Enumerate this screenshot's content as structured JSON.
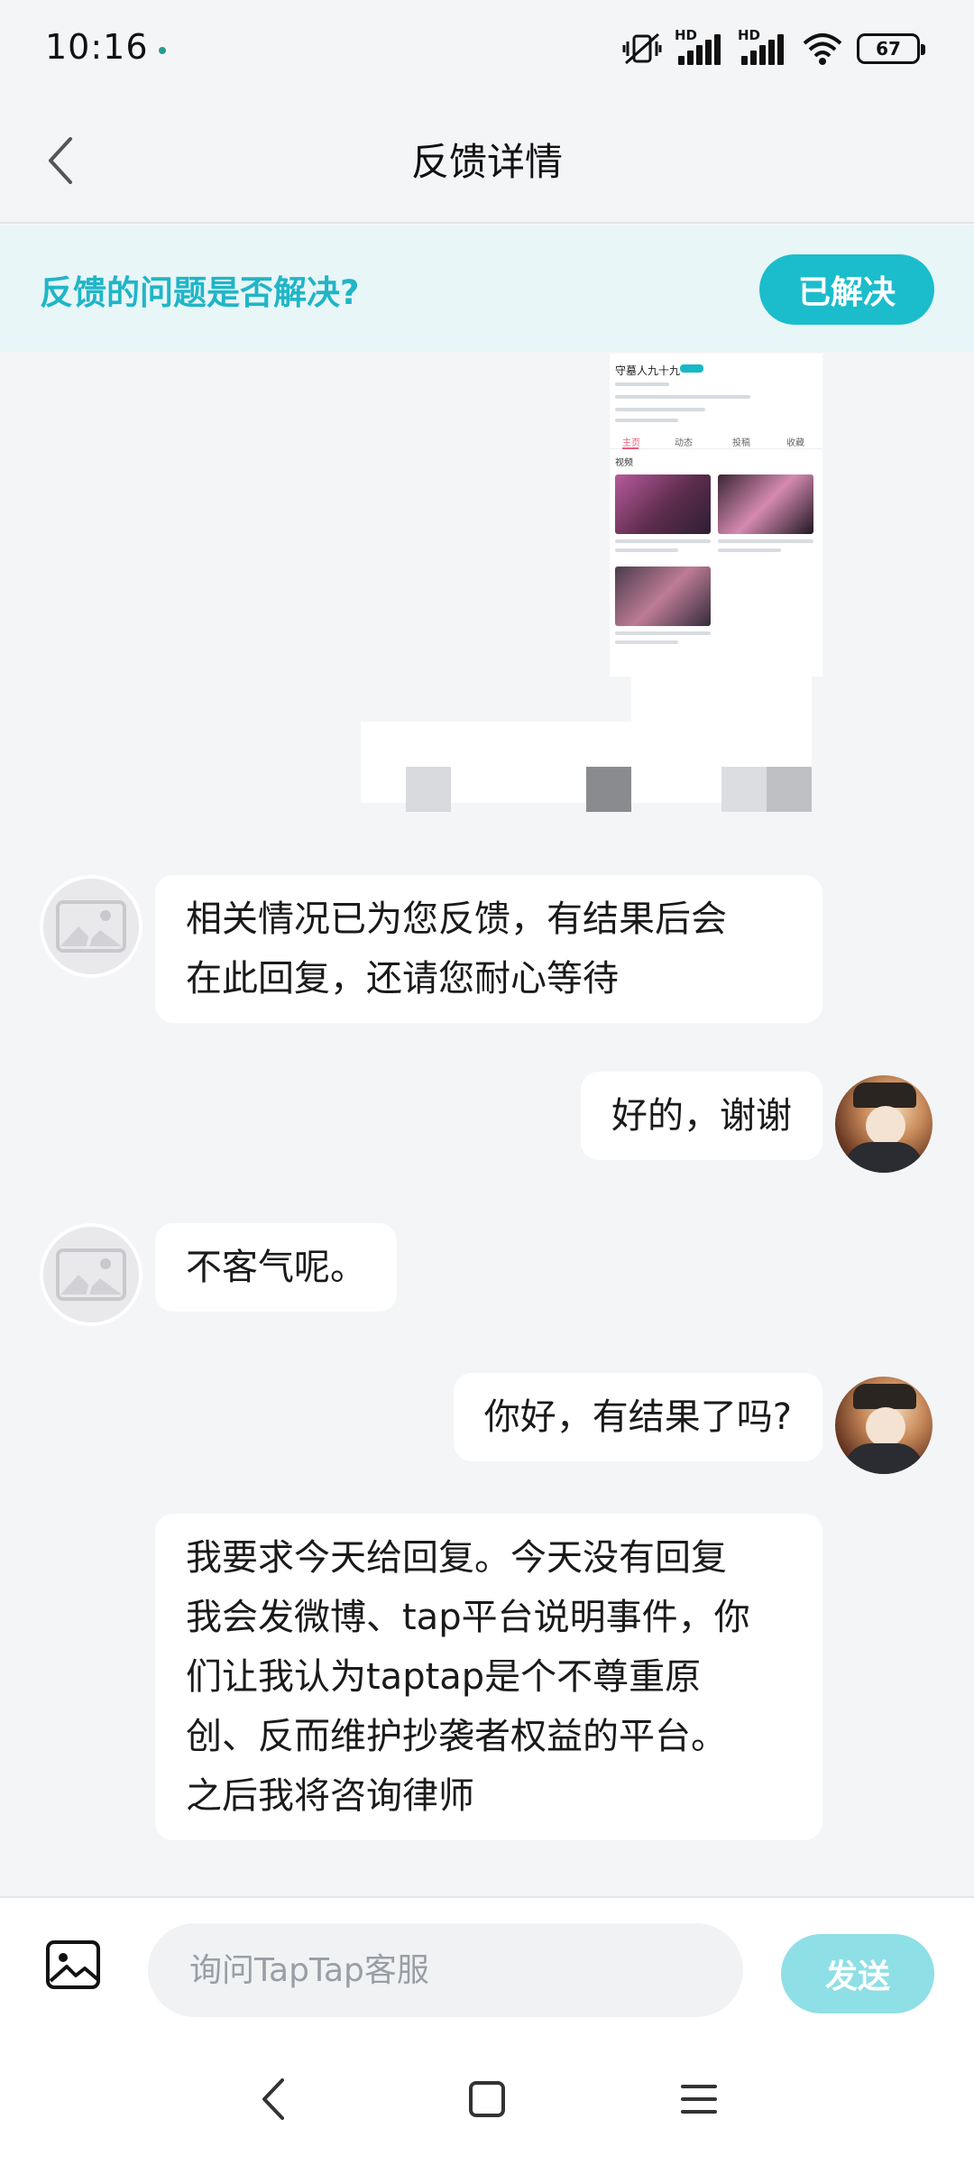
{
  "status_bar": {
    "time": "10:16",
    "hd_label_1": "HD",
    "hd_label_2": "HD",
    "battery_level": "67",
    "icons": [
      "mute-vibrate-icon",
      "signal-icon",
      "signal-icon",
      "wifi-icon",
      "battery-icon"
    ]
  },
  "header": {
    "title": "反馈详情",
    "back_icon": "chevron-left-icon"
  },
  "resolve_banner": {
    "question": "反馈的问题是否解决?",
    "button_label": "已解决",
    "accent_color": "#1bbdcc"
  },
  "messages": [
    {
      "sender": "support",
      "text": "相关情况已为您反馈，有结果后会\n在此回复，还请您耐心等待"
    },
    {
      "sender": "user",
      "text": "好的，谢谢"
    },
    {
      "sender": "support",
      "text": "不客气呢。"
    },
    {
      "sender": "user",
      "text": "你好，有结果了吗?"
    },
    {
      "sender": "user",
      "text": "我要求今天给回复。今天没有回复\n我会发微博、tap平台说明事件，你\n们让我认为taptap是个不尊重原\n创、反而维护抄袭者权益的平台。\n之后我将咨询律师"
    }
  ],
  "attachment_screenshot": {
    "profile_name": "守墓人九十九",
    "tabs": [
      "主页",
      "动态",
      "投稿",
      "收藏"
    ],
    "section_title": "视频"
  },
  "input_bar": {
    "placeholder": "询问TapTap客服",
    "send_label": "发送",
    "image_icon": "image-icon"
  },
  "nav_bar": {
    "icons": [
      "back-icon",
      "home-icon",
      "menu-icon"
    ]
  }
}
